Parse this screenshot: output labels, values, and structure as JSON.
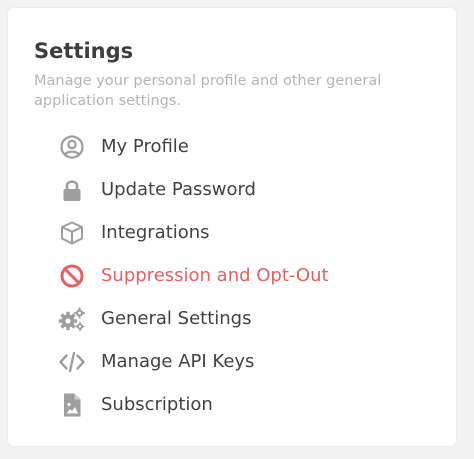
{
  "settings": {
    "title": "Settings",
    "subtitle": "Manage your personal profile and other general application settings."
  },
  "colors": {
    "icon": "#9e9e9e",
    "active": "#e5605e",
    "text": "#424242",
    "muted": "#b5b5b5"
  },
  "menu": {
    "items": [
      {
        "label": "My Profile",
        "icon": "user-circle-icon",
        "active": false
      },
      {
        "label": "Update Password",
        "icon": "lock-icon",
        "active": false
      },
      {
        "label": "Integrations",
        "icon": "cube-icon",
        "active": false
      },
      {
        "label": "Suppression and Opt-Out",
        "icon": "ban-icon",
        "active": true
      },
      {
        "label": "General Settings",
        "icon": "gears-icon",
        "active": false
      },
      {
        "label": "Manage API Keys",
        "icon": "code-icon",
        "active": false
      },
      {
        "label": "Subscription",
        "icon": "file-image-icon",
        "active": false
      }
    ]
  }
}
